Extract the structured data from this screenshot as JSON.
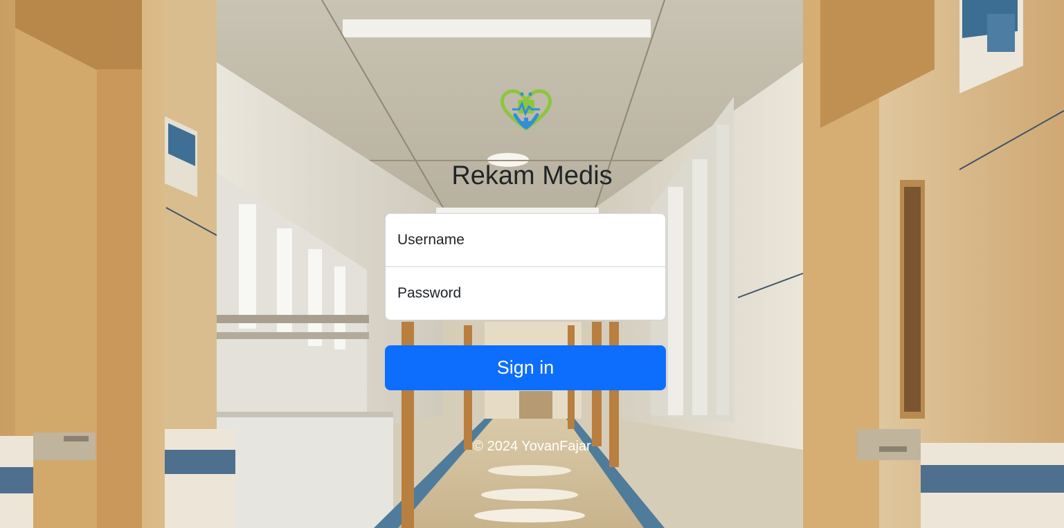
{
  "app": {
    "title": "Rekam Medis",
    "logo_icon": "heart-stethoscope-icon"
  },
  "login": {
    "username_placeholder": "Username",
    "password_placeholder": "Password",
    "signin_label": "Sign in"
  },
  "footer": {
    "text": "© 2024 YovanFajar"
  },
  "colors": {
    "primary": "#0d6efd",
    "title": "#212529",
    "logo_green": "#8cc63f",
    "logo_blue": "#2f8fd8"
  }
}
